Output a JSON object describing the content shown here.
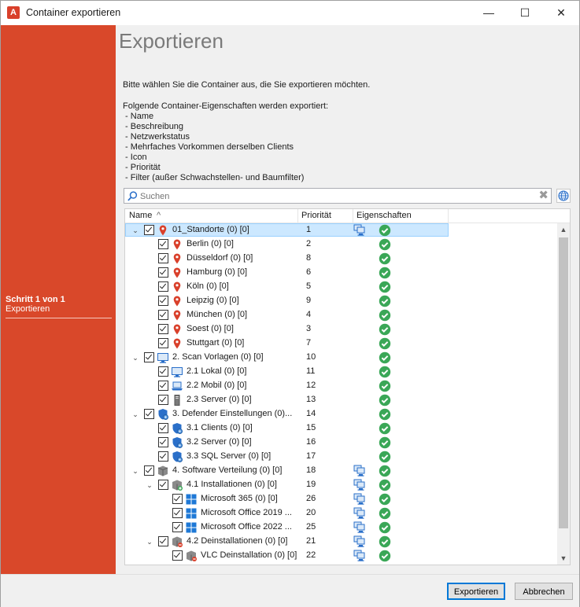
{
  "window": {
    "title": "Container exportieren",
    "app_icon_glyph": "A",
    "minimize_glyph": "—",
    "maximize_glyph": "☐",
    "close_glyph": "✕"
  },
  "sidebar": {
    "step_number": "Schritt 1 von 1",
    "step_name": "Exportieren",
    "accent": "#d9482a"
  },
  "main": {
    "headline": "Exportieren",
    "intro": "Bitte wählen Sie die Container aus, die Sie exportieren möchten.",
    "props_intro": "Folgende Container-Eigenschaften werden exportiert:",
    "props": [
      " - Name",
      " - Beschreibung",
      " - Netzwerkstatus",
      " - Mehrfaches Vorkommen derselben Clients",
      " - Icon",
      " - Priorität",
      " - Filter (außer Schwachstellen- und Baumfilter)"
    ]
  },
  "search": {
    "placeholder": "Suchen",
    "value": "",
    "clear_glyph": "✖"
  },
  "table": {
    "columns": {
      "name": "Name",
      "sort_glyph": "^",
      "priority": "Priorität",
      "properties": "Eigenschaften"
    },
    "rows": [
      {
        "level": 0,
        "expander": "⌄",
        "icon": "location-pin-icon",
        "name": "01_Standorte (0) [0]",
        "priority": "1",
        "export_icon": true,
        "selected": true
      },
      {
        "level": 1,
        "expander": "",
        "icon": "location-pin-icon",
        "name": "Berlin (0) [0]",
        "priority": "2",
        "export_icon": false
      },
      {
        "level": 1,
        "expander": "",
        "icon": "location-pin-icon",
        "name": "Düsseldorf (0) [0]",
        "priority": "8",
        "export_icon": false
      },
      {
        "level": 1,
        "expander": "",
        "icon": "location-pin-icon",
        "name": "Hamburg (0) [0]",
        "priority": "6",
        "export_icon": false
      },
      {
        "level": 1,
        "expander": "",
        "icon": "location-pin-icon",
        "name": "Köln (0) [0]",
        "priority": "5",
        "export_icon": false
      },
      {
        "level": 1,
        "expander": "",
        "icon": "location-pin-icon",
        "name": "Leipzig (0) [0]",
        "priority": "9",
        "export_icon": false
      },
      {
        "level": 1,
        "expander": "",
        "icon": "location-pin-icon",
        "name": "München (0) [0]",
        "priority": "4",
        "export_icon": false
      },
      {
        "level": 1,
        "expander": "",
        "icon": "location-pin-icon",
        "name": "Soest (0) [0]",
        "priority": "3",
        "export_icon": false
      },
      {
        "level": 1,
        "expander": "",
        "icon": "location-pin-icon",
        "name": "Stuttgart (0) [0]",
        "priority": "7",
        "export_icon": false
      },
      {
        "level": 0,
        "expander": "⌄",
        "icon": "monitor-icon",
        "name": "2. Scan Vorlagen (0) [0]",
        "priority": "10",
        "export_icon": false
      },
      {
        "level": 1,
        "expander": "",
        "icon": "monitor-icon",
        "name": "2.1 Lokal (0) [0]",
        "priority": "11",
        "export_icon": false
      },
      {
        "level": 1,
        "expander": "",
        "icon": "laptop-icon",
        "name": "2.2 Mobil (0) [0]",
        "priority": "12",
        "export_icon": false
      },
      {
        "level": 1,
        "expander": "",
        "icon": "server-icon",
        "name": "2.3 Server (0) [0]",
        "priority": "13",
        "export_icon": false
      },
      {
        "level": 0,
        "expander": "⌄",
        "icon": "shield-gear-icon",
        "name": "3. Defender Einstellungen (0)...",
        "priority": "14",
        "export_icon": false
      },
      {
        "level": 1,
        "expander": "",
        "icon": "shield-gear-icon",
        "name": "3.1 Clients (0) [0]",
        "priority": "15",
        "export_icon": false
      },
      {
        "level": 1,
        "expander": "",
        "icon": "shield-gear-icon",
        "name": "3.2 Server (0) [0]",
        "priority": "16",
        "export_icon": false
      },
      {
        "level": 1,
        "expander": "",
        "icon": "shield-gear-icon",
        "name": "3.3 SQL Server (0) [0]",
        "priority": "17",
        "export_icon": false
      },
      {
        "level": 0,
        "expander": "⌄",
        "icon": "software-package-icon",
        "name": "4. Software Verteilung (0) [0]",
        "priority": "18",
        "export_icon": true
      },
      {
        "level": 1,
        "expander": "⌄",
        "icon": "software-install-icon",
        "name": "4.1 Installationen (0) [0]",
        "priority": "19",
        "export_icon": true
      },
      {
        "level": 2,
        "expander": "",
        "icon": "windows-logo-icon",
        "name": "Microsoft 365 (0) [0]",
        "priority": "26",
        "export_icon": true
      },
      {
        "level": 2,
        "expander": "",
        "icon": "windows-logo-icon",
        "name": "Microsoft Office 2019 ...",
        "priority": "20",
        "export_icon": true
      },
      {
        "level": 2,
        "expander": "",
        "icon": "windows-logo-icon",
        "name": "Microsoft Office 2022 ...",
        "priority": "25",
        "export_icon": true
      },
      {
        "level": 1,
        "expander": "⌄",
        "icon": "software-uninstall-icon",
        "name": "4.2 Deinstallationen (0) [0]",
        "priority": "21",
        "export_icon": true
      },
      {
        "level": 2,
        "expander": "",
        "icon": "software-uninstall-icon",
        "name": "VLC Deinstallation (0) [0]",
        "priority": "22",
        "export_icon": true
      }
    ]
  },
  "footer": {
    "export_button": "Exportieren",
    "cancel_button": "Abbrechen"
  },
  "colors": {
    "pin": "#d9402b",
    "check": "#3aa757",
    "computer": "#2a7bd0",
    "selection": "#cce8ff"
  }
}
